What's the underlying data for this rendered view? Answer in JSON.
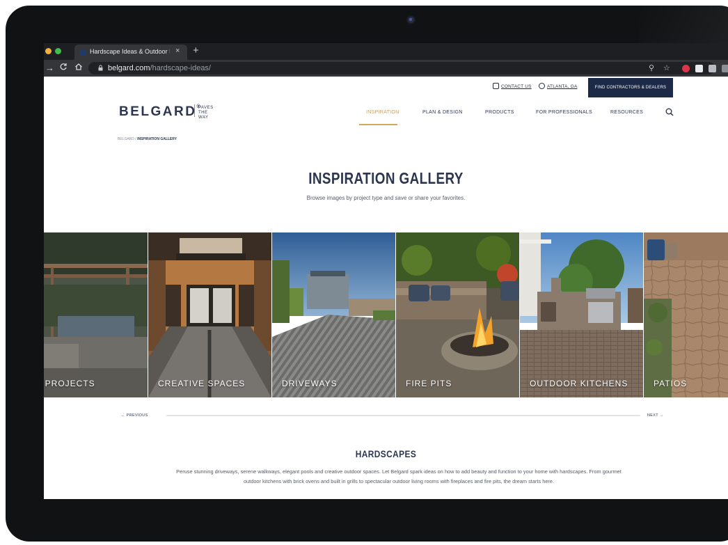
{
  "browser": {
    "tab_title": "Hardscape Ideas & Outdoor Li",
    "tab_close": "×",
    "new_tab": "+",
    "url_host": "belgard.com",
    "url_path": "/hardscape-ideas/"
  },
  "header": {
    "contact_label": "CONTACT US",
    "location_label": "ATLANTA, GA",
    "find_button": "FIND CONTRACTORS & DEALERS",
    "logo": "BELGARD",
    "logo_reg": "®",
    "tagline": "PAVES THE WAY",
    "nav": [
      {
        "label": "INSPIRATION"
      },
      {
        "label": "PLAN & DESIGN"
      },
      {
        "label": "PRODUCTS"
      },
      {
        "label": "FOR PROFESSIONALS"
      },
      {
        "label": "RESOURCES"
      }
    ]
  },
  "breadcrumb": {
    "root": "BELGARD",
    "separator": " / ",
    "current": "INSPIRATION GALLERY"
  },
  "page": {
    "title": "INSPIRATION GALLERY",
    "subtitle": "Browse images by project type and save or share your favorites."
  },
  "gallery": {
    "tiles": [
      {
        "label": ". PROJECTS"
      },
      {
        "label": "CREATIVE SPACES"
      },
      {
        "label": "DRIVEWAYS"
      },
      {
        "label": "FIRE PITS"
      },
      {
        "label": "OUTDOOR KITCHENS"
      },
      {
        "label": "PATIOS"
      }
    ],
    "prev_label": "←  PREVIOUS",
    "next_label": "NEXT  →"
  },
  "section": {
    "title": "HARDSCAPES",
    "body": "Peruse stunning driveways, serene walkways, elegant pools and creative outdoor spaces. Let Belgard spark ideas on how to add beauty and function to your home with hardscapes. From gourmet outdoor kitchens with brick ovens and built in grills to spectacular outdoor living rooms with fireplaces and fire pits, the dream starts here."
  },
  "colors": {
    "brand_navy": "#1c2a48",
    "accent_gold": "#d4a857",
    "bezel": "#111214"
  }
}
